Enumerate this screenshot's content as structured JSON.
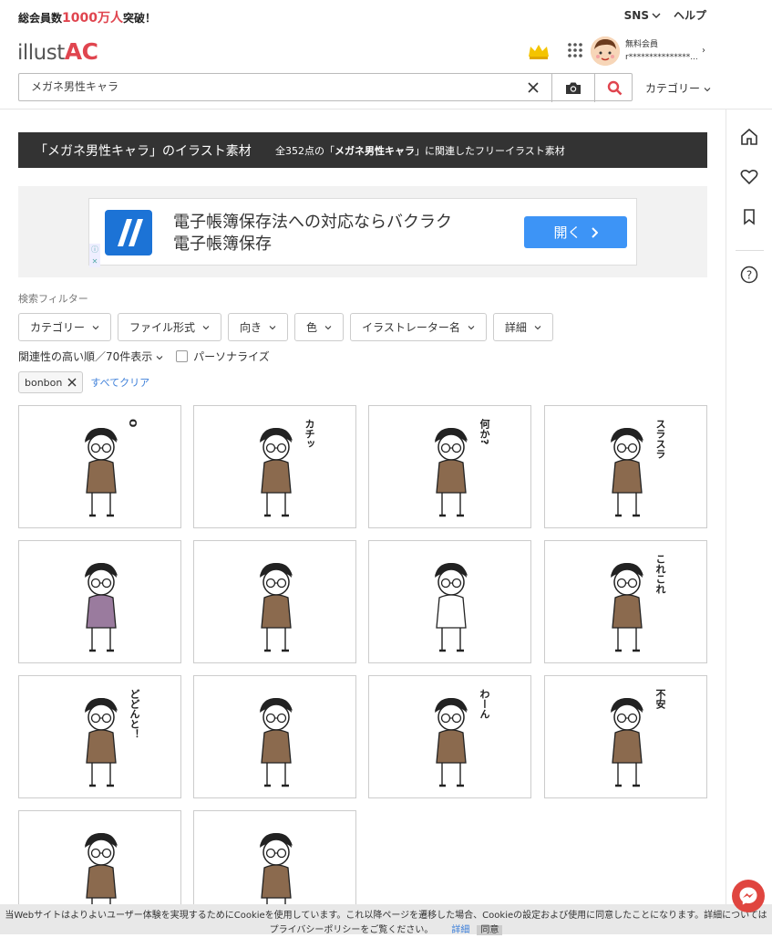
{
  "topbar": {
    "promo_prefix": "総会員数",
    "promo_number": "1000万人",
    "promo_suffix": "突破！",
    "sns": "SNS",
    "help": "ヘルプ"
  },
  "header": {
    "logo_text": "illust",
    "logo_accent": "AC",
    "member_type": "無料会員",
    "member_name": "r***************...さん"
  },
  "search": {
    "value": "メガネ男性キャラ",
    "category_label": "カテゴリー"
  },
  "title": {
    "main": "「メガネ男性キャラ」のイラスト素材",
    "sub_prefix": "全352点の「",
    "sub_keyword": "メガネ男性キャラ",
    "sub_suffix": "」に関連したフリーイラスト素材"
  },
  "ad": {
    "line1": "電子帳簿保存法への対応ならバクラク",
    "line2": "電子帳簿保存",
    "button": "開く"
  },
  "filters": {
    "label": "検索フィルター",
    "items": [
      "カテゴリー",
      "ファイル形式",
      "向き",
      "色",
      "イラストレーター名",
      "詳細"
    ]
  },
  "sort": {
    "label": "関連性の高い順／70件表示",
    "personalize": "パーソナライズ"
  },
  "tags": {
    "active": "bonbon",
    "clear_all": "すべてクリア"
  },
  "illustrations": [
    {
      "label": "O"
    },
    {
      "label": "カチッ"
    },
    {
      "label": "何か?"
    },
    {
      "label": "スラスラ"
    },
    {
      "label": ""
    },
    {
      "label": ""
    },
    {
      "label": ""
    },
    {
      "label": "これこれ"
    },
    {
      "label": "どどんと！"
    },
    {
      "label": ""
    },
    {
      "label": "わーん"
    },
    {
      "label": "不安"
    },
    {
      "label": ""
    },
    {
      "label": ""
    }
  ],
  "cookie": {
    "line1": "当Webサイトはよりよいユーザー体験を実現するためにCookieを使用しています。これ以降ページを遷移した場合、Cookieの設定および使用に同意したことになります。詳細については",
    "line2": "プライバシーポリシーをご覧ください。",
    "details": "詳細",
    "agree": "同意"
  },
  "colors": {
    "accent": "#e0454f",
    "dark_bar": "#333333",
    "ad_button": "#3d94f6",
    "link": "#3d7fd9"
  }
}
